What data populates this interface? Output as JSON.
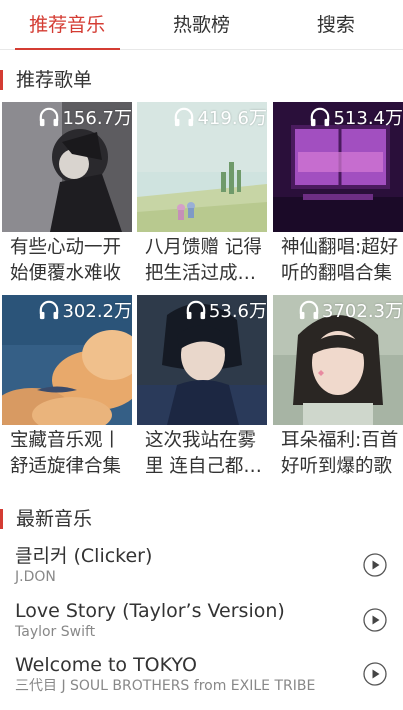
{
  "tabs": [
    {
      "label": "推荐音乐",
      "active": true
    },
    {
      "label": "热歌榜",
      "active": false
    },
    {
      "label": "搜索",
      "active": false
    }
  ],
  "recommend": {
    "title": "推荐歌单",
    "playlists": [
      {
        "count": "156.7万",
        "title": "有些心动一开始便覆水难收",
        "icon": "headphones-icon"
      },
      {
        "count": "419.6万",
        "title": "八月馈赠 记得把生活过成想要的样子",
        "icon": "headphones-icon"
      },
      {
        "count": "513.4万",
        "title": "神仙翻唱:超好听的翻唱合集",
        "icon": "headphones-icon"
      },
      {
        "count": "302.2万",
        "title": "宝藏音乐观丨舒适旋律合集",
        "icon": "headphones-icon"
      },
      {
        "count": "53.6万",
        "title": "这次我站在雾里 连自己都看不清",
        "icon": "headphones-icon"
      },
      {
        "count": "3702.3万",
        "title": "耳朵福利:百首好听到爆的歌",
        "icon": "headphones-icon"
      }
    ]
  },
  "newest": {
    "title": "最新音乐",
    "songs": [
      {
        "name": "클리커 (Clicker)",
        "artist": "J.DON",
        "icon": "play-icon"
      },
      {
        "name": "Love Story (Taylor’s Version)",
        "artist": "Taylor Swift",
        "icon": "play-icon"
      },
      {
        "name": "Welcome to TOKYO",
        "artist": "三代目 J SOUL BROTHERS from EXILE TRIBE",
        "icon": "play-icon"
      }
    ]
  },
  "colors": {
    "accent": "#d43c33",
    "text": "#333333",
    "subtext": "#888888"
  }
}
